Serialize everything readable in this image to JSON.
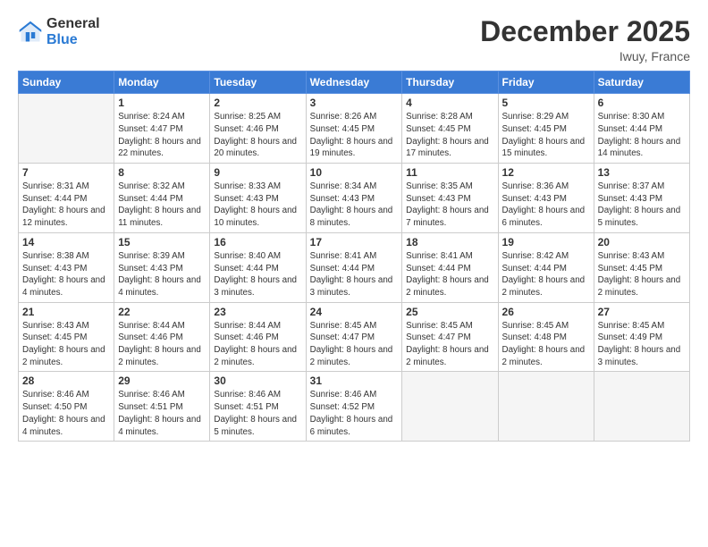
{
  "header": {
    "logo_general": "General",
    "logo_blue": "Blue",
    "month_title": "December 2025",
    "location": "Iwuy, France"
  },
  "days_of_week": [
    "Sunday",
    "Monday",
    "Tuesday",
    "Wednesday",
    "Thursday",
    "Friday",
    "Saturday"
  ],
  "weeks": [
    [
      {
        "day": "",
        "empty": true
      },
      {
        "day": "1",
        "sunrise": "8:24 AM",
        "sunset": "4:47 PM",
        "daylight": "8 hours and 22 minutes."
      },
      {
        "day": "2",
        "sunrise": "8:25 AM",
        "sunset": "4:46 PM",
        "daylight": "8 hours and 20 minutes."
      },
      {
        "day": "3",
        "sunrise": "8:26 AM",
        "sunset": "4:45 PM",
        "daylight": "8 hours and 19 minutes."
      },
      {
        "day": "4",
        "sunrise": "8:28 AM",
        "sunset": "4:45 PM",
        "daylight": "8 hours and 17 minutes."
      },
      {
        "day": "5",
        "sunrise": "8:29 AM",
        "sunset": "4:45 PM",
        "daylight": "8 hours and 15 minutes."
      },
      {
        "day": "6",
        "sunrise": "8:30 AM",
        "sunset": "4:44 PM",
        "daylight": "8 hours and 14 minutes."
      }
    ],
    [
      {
        "day": "7",
        "sunrise": "8:31 AM",
        "sunset": "4:44 PM",
        "daylight": "8 hours and 12 minutes."
      },
      {
        "day": "8",
        "sunrise": "8:32 AM",
        "sunset": "4:44 PM",
        "daylight": "8 hours and 11 minutes."
      },
      {
        "day": "9",
        "sunrise": "8:33 AM",
        "sunset": "4:43 PM",
        "daylight": "8 hours and 10 minutes."
      },
      {
        "day": "10",
        "sunrise": "8:34 AM",
        "sunset": "4:43 PM",
        "daylight": "8 hours and 8 minutes."
      },
      {
        "day": "11",
        "sunrise": "8:35 AM",
        "sunset": "4:43 PM",
        "daylight": "8 hours and 7 minutes."
      },
      {
        "day": "12",
        "sunrise": "8:36 AM",
        "sunset": "4:43 PM",
        "daylight": "8 hours and 6 minutes."
      },
      {
        "day": "13",
        "sunrise": "8:37 AM",
        "sunset": "4:43 PM",
        "daylight": "8 hours and 5 minutes."
      }
    ],
    [
      {
        "day": "14",
        "sunrise": "8:38 AM",
        "sunset": "4:43 PM",
        "daylight": "8 hours and 4 minutes."
      },
      {
        "day": "15",
        "sunrise": "8:39 AM",
        "sunset": "4:43 PM",
        "daylight": "8 hours and 4 minutes."
      },
      {
        "day": "16",
        "sunrise": "8:40 AM",
        "sunset": "4:44 PM",
        "daylight": "8 hours and 3 minutes."
      },
      {
        "day": "17",
        "sunrise": "8:41 AM",
        "sunset": "4:44 PM",
        "daylight": "8 hours and 3 minutes."
      },
      {
        "day": "18",
        "sunrise": "8:41 AM",
        "sunset": "4:44 PM",
        "daylight": "8 hours and 2 minutes."
      },
      {
        "day": "19",
        "sunrise": "8:42 AM",
        "sunset": "4:44 PM",
        "daylight": "8 hours and 2 minutes."
      },
      {
        "day": "20",
        "sunrise": "8:43 AM",
        "sunset": "4:45 PM",
        "daylight": "8 hours and 2 minutes."
      }
    ],
    [
      {
        "day": "21",
        "sunrise": "8:43 AM",
        "sunset": "4:45 PM",
        "daylight": "8 hours and 2 minutes."
      },
      {
        "day": "22",
        "sunrise": "8:44 AM",
        "sunset": "4:46 PM",
        "daylight": "8 hours and 2 minutes."
      },
      {
        "day": "23",
        "sunrise": "8:44 AM",
        "sunset": "4:46 PM",
        "daylight": "8 hours and 2 minutes."
      },
      {
        "day": "24",
        "sunrise": "8:45 AM",
        "sunset": "4:47 PM",
        "daylight": "8 hours and 2 minutes."
      },
      {
        "day": "25",
        "sunrise": "8:45 AM",
        "sunset": "4:47 PM",
        "daylight": "8 hours and 2 minutes."
      },
      {
        "day": "26",
        "sunrise": "8:45 AM",
        "sunset": "4:48 PM",
        "daylight": "8 hours and 2 minutes."
      },
      {
        "day": "27",
        "sunrise": "8:45 AM",
        "sunset": "4:49 PM",
        "daylight": "8 hours and 3 minutes."
      }
    ],
    [
      {
        "day": "28",
        "sunrise": "8:46 AM",
        "sunset": "4:50 PM",
        "daylight": "8 hours and 4 minutes."
      },
      {
        "day": "29",
        "sunrise": "8:46 AM",
        "sunset": "4:51 PM",
        "daylight": "8 hours and 4 minutes."
      },
      {
        "day": "30",
        "sunrise": "8:46 AM",
        "sunset": "4:51 PM",
        "daylight": "8 hours and 5 minutes."
      },
      {
        "day": "31",
        "sunrise": "8:46 AM",
        "sunset": "4:52 PM",
        "daylight": "8 hours and 6 minutes."
      },
      {
        "day": "",
        "empty": true
      },
      {
        "day": "",
        "empty": true
      },
      {
        "day": "",
        "empty": true
      }
    ]
  ]
}
